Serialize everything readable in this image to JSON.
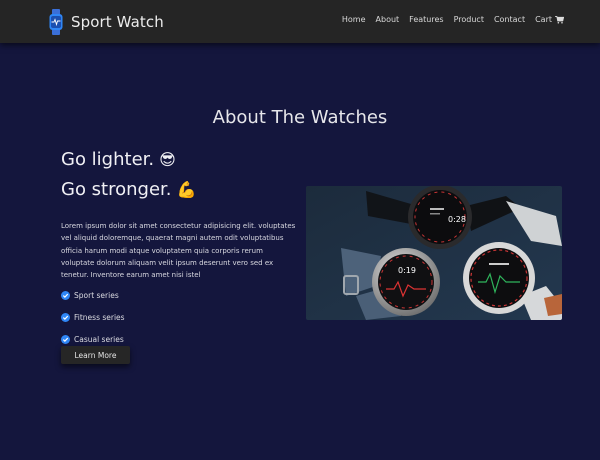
{
  "navbar": {
    "brand": "Sport Watch",
    "brand_icon": "smartwatch-icon",
    "links": [
      "Home",
      "About",
      "Features",
      "Product",
      "Contact",
      "Cart"
    ],
    "cart_icon": "shopping-cart-icon"
  },
  "about": {
    "title": "About The Watches",
    "headline_1": "Go lighter.",
    "headline_1_emoji": "😎",
    "headline_2": "Go stronger.",
    "headline_2_emoji": "💪",
    "description": "Lorem ipsum dolor sit amet consectetur adipisicing elit. voluptates vel aliquid doloremque, quaerat magni autem odit voluptatibus officia harum modi atque voluptatem quia corporis rerum voluptate dolorum aliquam velit ipsum deserunt vero sed ex tenetur. Inventore earum amet nisi istel",
    "features": [
      "Sport series",
      "Fitness series",
      "Casual series"
    ],
    "check_icon": "check-circle-icon",
    "button_label": "Learn More",
    "image_alt": "watches-photo"
  },
  "watch_faces": [
    "0:28",
    "0:19"
  ],
  "colors": {
    "navbar_bg": "#252525",
    "page_bg": "#14163d",
    "check_blue": "#2f86f6",
    "button_bg": "#262626"
  }
}
